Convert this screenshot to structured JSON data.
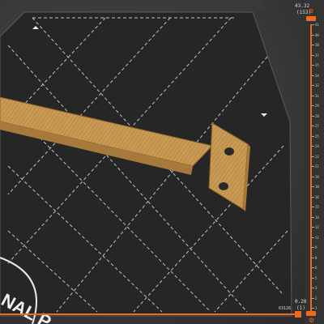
{
  "bed": {
    "label_text": "NAL P",
    "bed_color": "#2b2b2b",
    "grid_color": "#dddddd"
  },
  "model": {
    "color": "#c89a54"
  },
  "layer_slider": {
    "top_value": "43.32",
    "top_layer": "(153)",
    "bottom_value": "0.20",
    "bottom_layer": "(1)",
    "accent_color": "#ed6b21",
    "tick_labels": [
      "41",
      "40",
      "38",
      "37",
      "35",
      "34",
      "32",
      "31",
      "29",
      "28",
      "27",
      "25",
      "24",
      "22",
      "21",
      "19",
      "18",
      "16",
      "15",
      "14",
      "12",
      "11",
      "9",
      "8",
      "6",
      "5",
      "3",
      "2",
      "1"
    ]
  },
  "horizontal_slider": {
    "value": "63126"
  },
  "icons": {
    "settings": "gear-icon",
    "cog_bottom": "cog-icon"
  }
}
